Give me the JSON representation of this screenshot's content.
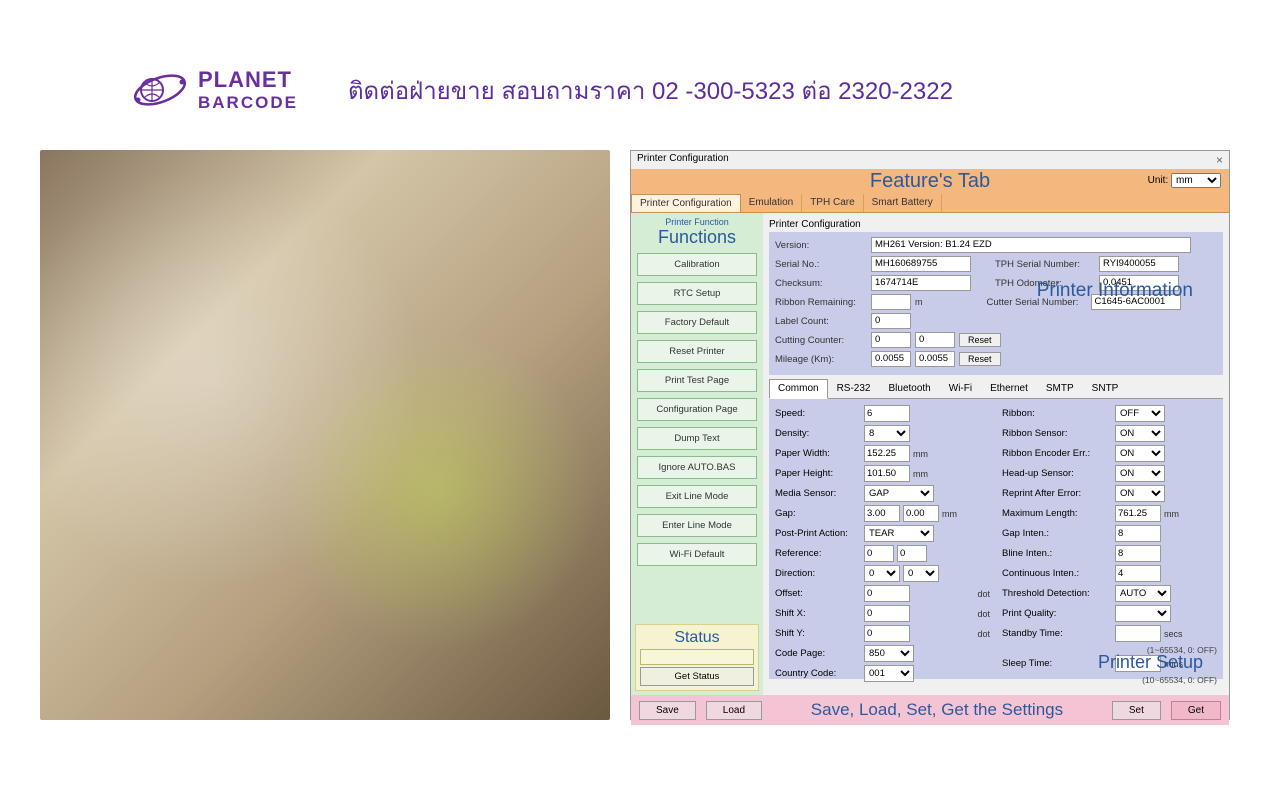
{
  "header": {
    "logo1": "PLANET",
    "logo2": "BARCODE",
    "tagline": "ติดต่อฝ่ายขาย สอบถามราคา 02 -300-5323  ต่อ 2320-2322"
  },
  "app": {
    "winTitle": "Printer Configuration",
    "featureTab": "Feature's Tab",
    "unitLabel": "Unit:",
    "unitValue": "mm",
    "tabs": [
      "Printer Configuration",
      "Emulation",
      "TPH Care",
      "Smart Battery"
    ],
    "sidebar": {
      "heading": "Printer Function",
      "title": "Functions",
      "buttons": [
        "Calibration",
        "RTC Setup",
        "Factory Default",
        "Reset Printer",
        "Print Test Page",
        "Configuration Page",
        "Dump Text",
        "Ignore AUTO.BAS",
        "Exit Line Mode",
        "Enter Line Mode",
        "Wi-Fi Default"
      ],
      "statusTitle": "Status",
      "getStatus": "Get Status"
    },
    "sectionLabel": "Printer Configuration",
    "info": {
      "overlayTitle": "Printer Information",
      "version_l": "Version:",
      "version_v": "MH261 Version: B1.24 EZD",
      "serial_l": "Serial No.:",
      "serial_v": "MH160689755",
      "tphserial_l": "TPH Serial Number:",
      "tphserial_v": "RYI9400055",
      "checksum_l": "Checksum:",
      "checksum_v": "1674714E",
      "tphod_l": "TPH Odometer:",
      "tphod_v": "0.0451",
      "ribbon_l": "Ribbon Remaining:",
      "ribbon_v": "",
      "ribbon_u": "m",
      "cutter_l": "Cutter Serial Number:",
      "cutter_v": "C1645-6AC0001",
      "labelcount_l": "Label Count:",
      "labelcount_v": "0",
      "cutcount_l": "Cutting Counter:",
      "cutcount_v1": "0",
      "cutcount_v2": "0",
      "mileage_l": "Mileage (Km):",
      "mileage_v1": "0.0055",
      "mileage_v2": "0.0055",
      "reset": "Reset"
    },
    "subtabs": [
      "Common",
      "RS-232",
      "Bluetooth",
      "Wi-Fi",
      "Ethernet",
      "SMTP",
      "SNTP"
    ],
    "settings": {
      "overlayTitle": "Printer Setup",
      "left": {
        "speed_l": "Speed:",
        "speed_v": "6",
        "density_l": "Density:",
        "density_v": "8",
        "pwidth_l": "Paper Width:",
        "pwidth_v": "152.25",
        "pwidth_u": "mm",
        "pheight_l": "Paper Height:",
        "pheight_v": "101.50",
        "pheight_u": "mm",
        "msensor_l": "Media Sensor:",
        "msensor_v": "GAP",
        "gap_l": "Gap:",
        "gap_v1": "3.00",
        "gap_v2": "0.00",
        "gap_u": "mm",
        "ppa_l": "Post-Print Action:",
        "ppa_v": "TEAR",
        "ref_l": "Reference:",
        "ref_v1": "0",
        "ref_v2": "0",
        "dir_l": "Direction:",
        "dir_v1": "0",
        "dir_v2": "0",
        "off_l": "Offset:",
        "off_v": "0",
        "off_u": "dot",
        "shx_l": "Shift X:",
        "shx_v": "0",
        "shx_u": "dot",
        "shy_l": "Shift Y:",
        "shy_v": "0",
        "shy_u": "dot",
        "cp_l": "Code Page:",
        "cp_v": "850",
        "cc_l": "Country Code:",
        "cc_v": "001"
      },
      "right": {
        "ribbon_l": "Ribbon:",
        "ribbon_v": "OFF",
        "rsens_l": "Ribbon Sensor:",
        "rsens_v": "ON",
        "renc_l": "Ribbon Encoder Err.:",
        "renc_v": "ON",
        "hup_l": "Head-up Sensor:",
        "hup_v": "ON",
        "rae_l": "Reprint After Error:",
        "rae_v": "ON",
        "maxl_l": "Maximum Length:",
        "maxl_v": "761.25",
        "maxl_u": "mm",
        "gi_l": "Gap Inten.:",
        "gi_v": "8",
        "bi_l": "Bline Inten.:",
        "bi_v": "8",
        "ci_l": "Continuous Inten.:",
        "ci_v": "4",
        "td_l": "Threshold Detection:",
        "td_v": "AUTO",
        "pq_l": "Print Quality:",
        "pq_v": "",
        "st_l": "Standby Time:",
        "st_v": "",
        "st_u": "secs",
        "st_hint": "(1~65534, 0: OFF)",
        "sl_l": "Sleep Time:",
        "sl_v": "",
        "sl_u": "mins",
        "sl_hint": "(10~65534, 0: OFF)"
      }
    },
    "footer": {
      "save": "Save",
      "load": "Load",
      "text": "Save, Load, Set, Get the Settings",
      "set": "Set",
      "get": "Get"
    }
  }
}
